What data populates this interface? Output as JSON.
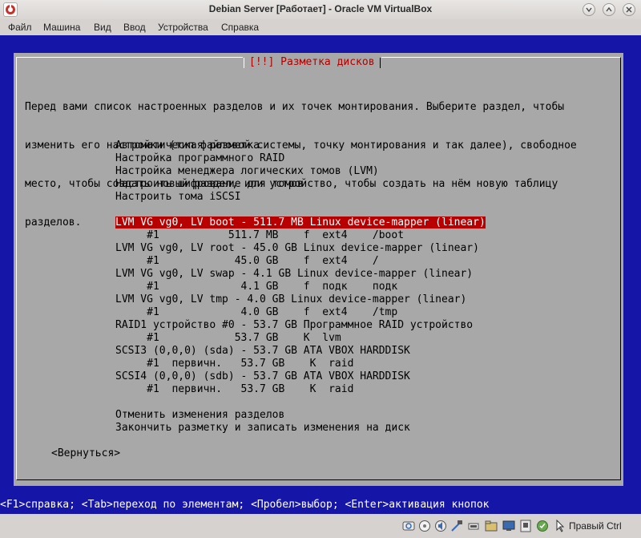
{
  "window": {
    "title": "Debian Server [Работает] - Oracle VM VirtualBox"
  },
  "menubar": {
    "items": [
      "Файл",
      "Машина",
      "Вид",
      "Ввод",
      "Устройства",
      "Справка"
    ]
  },
  "dialog": {
    "title": "[!!] Разметка дисков",
    "description": [
      "Перед вами список настроенных разделов и их точек монтирования. Выберите раздел, чтобы",
      "изменить его настройки (тип файловой системы, точку монтирования и так далее), свободное",
      "место, чтобы создать новый раздел, или устройство, чтобы создать на нём новую таблицу",
      "разделов."
    ],
    "items": [
      "Автоматическая разметка",
      "Настройка программного RAID",
      "Настройка менеджера логических томов (LVM)",
      "Настроить шифрование для томов",
      "Настроить тома iSCSI",
      "",
      "LVM VG vg0, LV boot - 511.7 MB Linux device-mapper (linear)",
      "     #1           511.7 MB    f  ext4    /boot",
      "LVM VG vg0, LV root - 45.0 GB Linux device-mapper (linear)",
      "     #1            45.0 GB    f  ext4    /",
      "LVM VG vg0, LV swap - 4.1 GB Linux device-mapper (linear)",
      "     #1             4.1 GB    f  подк    подк",
      "LVM VG vg0, LV tmp - 4.0 GB Linux device-mapper (linear)",
      "     #1             4.0 GB    f  ext4    /tmp",
      "RAID1 устройство #0 - 53.7 GB Программное RAID устройство",
      "     #1            53.7 GB    K  lvm",
      "SCSI3 (0,0,0) (sda) - 53.7 GB ATA VBOX HARDDISK",
      "     #1  первичн.   53.7 GB    K  raid",
      "SCSI4 (0,0,0) (sdb) - 53.7 GB ATA VBOX HARDDISK",
      "     #1  первичн.   53.7 GB    K  raid",
      "",
      "Отменить изменения разделов",
      "Закончить разметку и записать изменения на диск"
    ],
    "selected_index": 6,
    "back_button": "<Вернуться>"
  },
  "installer_status": "<F1>справка; <Tab>переход по элементам; <Пробел>выбор; <Enter>активация кнопок",
  "statusbar": {
    "icons": [
      "hdd-icon",
      "optical-disc-icon",
      "audio-icon",
      "network-icon",
      "usb-icon",
      "shared-folders-icon",
      "display-icon",
      "video-capture-icon",
      "cpu-icon",
      "mouse-integration-icon",
      "keyboard-icon"
    ],
    "host_key": "Правый Ctrl"
  },
  "colors": {
    "vm_background": "#1515a8",
    "dialog_background": "#a8a8a8",
    "selection": "#b80000",
    "dialog_title": "#b00000"
  }
}
